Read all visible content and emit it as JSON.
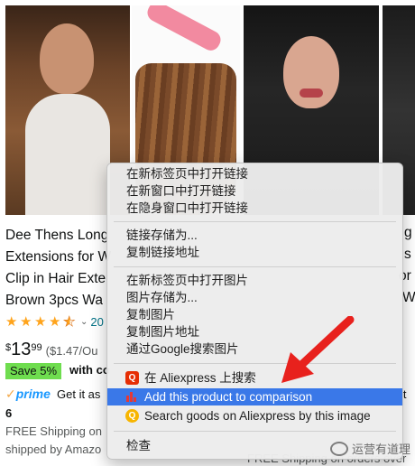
{
  "product1": {
    "title_lines": [
      "Dee Thens Long",
      "Extensions for W",
      "Clip in Hair Exte",
      "Brown 3pcs Wa"
    ],
    "rating_caret": "⌄",
    "rating_count": "20",
    "price_symbol": "$",
    "price_whole": "13",
    "price_fraction": "99",
    "unit_price": "($1.47/Ou",
    "save_badge": "Save 5%",
    "with_coupon": "with co",
    "prime_label": "prime",
    "get_it": "Get it as",
    "delivery_day": "6",
    "shipping_line1": "FREE Shipping on",
    "shipping_line2": "shipped by Amazo"
  },
  "product2": {
    "title_fragments": [
      "g",
      "s",
      "or",
      "W"
    ],
    "prime_partial": "it",
    "shipping_partial": "FREE Shipping on orders over"
  },
  "context_menu": {
    "items": [
      {
        "label": "在新标签页中打开链接"
      },
      {
        "label": "在新窗口中打开链接"
      },
      {
        "label": "在隐身窗口中打开链接"
      },
      {
        "label": "链接存储为..."
      },
      {
        "label": "复制链接地址"
      },
      {
        "label": "在新标签页中打开图片"
      },
      {
        "label": "图片存储为..."
      },
      {
        "label": "复制图片"
      },
      {
        "label": "复制图片地址"
      },
      {
        "label": "通过Google搜索图片"
      },
      {
        "label": "在 Aliexpress 上搜索",
        "icon": "aliexpress-icon"
      },
      {
        "label": "Add this product to comparison",
        "icon": "comparison-chart-icon",
        "highlighted": true
      },
      {
        "label": "Search goods on Aliexpress by this image",
        "icon": "image-search-icon"
      },
      {
        "label": "检查"
      }
    ]
  },
  "watermark": {
    "text": "运营有道理"
  },
  "colors": {
    "menu_highlight": "#3a78e8",
    "annotation_arrow": "#e8211d",
    "star": "#ffa41c",
    "save_badge": "#6fdd4f",
    "link": "#007185"
  }
}
